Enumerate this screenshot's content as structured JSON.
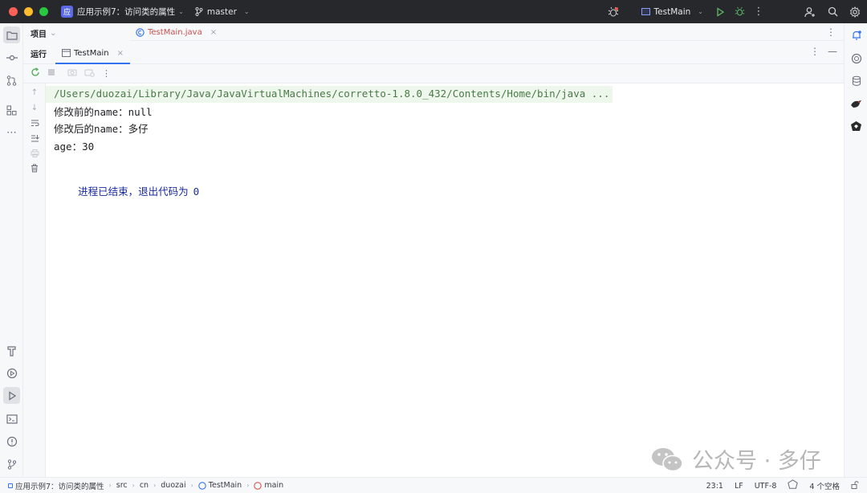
{
  "titlebar": {
    "project_badge": "应",
    "project_name": "应用示例7：访问类的属性",
    "branch": "master",
    "run_config": "TestMain",
    "icons": [
      "bug-icon",
      "run-config-icon",
      "run-icon",
      "debug-icon",
      "more-icon",
      "add-user-icon",
      "search-icon",
      "settings-icon"
    ]
  },
  "sidebar": {
    "icons": [
      "folder-icon",
      "commit-icon",
      "pull-request-icon",
      "structure-icon",
      "more-icon",
      "build-icon",
      "services-icon",
      "run-icon",
      "terminal-icon",
      "problems-icon",
      "git-icon"
    ]
  },
  "rightbar": {
    "icons": [
      "notifications-icon",
      "ai-assistant-icon",
      "database-icon",
      "bird-icon",
      "plugin-icon"
    ]
  },
  "project_panel": {
    "label": "项目"
  },
  "editor": {
    "tab_label": "TestMain.java",
    "tab_close": "×"
  },
  "run_panel": {
    "label": "运行",
    "tab_label": "TestMain",
    "tab_close": "×"
  },
  "console": {
    "command": "/Users/duozai/Library/Java/JavaVirtualMachines/corretto-1.8.0_432/Contents/Home/bin/java ...",
    "lines": [
      "修改前的name：null",
      "修改后的name：多仔",
      "age：30"
    ],
    "exit_text": "进程已结束，退出代码为",
    "exit_code": "0"
  },
  "watermark": {
    "text": "公众号 · 多仔"
  },
  "statusbar": {
    "crumbs": [
      "应用示例7：访问类的属性",
      "src",
      "cn",
      "duozai",
      "TestMain",
      "main"
    ],
    "position": "23:1",
    "line_ending": "LF",
    "encoding": "UTF-8",
    "indent": "4 个空格"
  }
}
